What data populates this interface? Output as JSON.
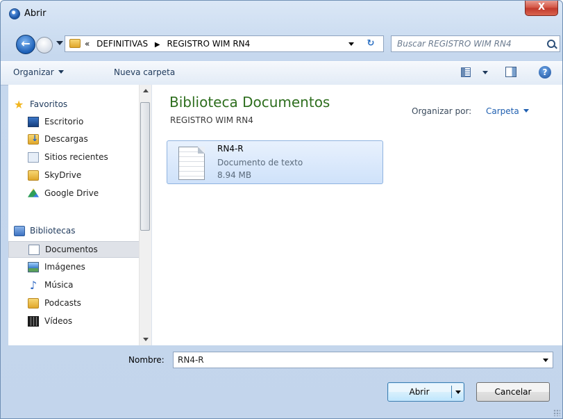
{
  "window": {
    "title": "Abrir",
    "close_label": "X"
  },
  "address": {
    "overflow": "«",
    "crumbs": [
      "DEFINITIVAS",
      "REGISTRO WIM RN4"
    ]
  },
  "search": {
    "placeholder": "Buscar REGISTRO WIM RN4"
  },
  "toolbar": {
    "organize": "Organizar",
    "new_folder": "Nueva carpeta"
  },
  "sidebar": {
    "favorites": {
      "label": "Favoritos",
      "items": [
        {
          "label": "Escritorio",
          "icon": "desktop-icon"
        },
        {
          "label": "Descargas",
          "icon": "downloads-icon"
        },
        {
          "label": "Sitios recientes",
          "icon": "recent-places-icon"
        },
        {
          "label": "SkyDrive",
          "icon": "folder-icon"
        },
        {
          "label": "Google Drive",
          "icon": "google-drive-icon"
        }
      ]
    },
    "libraries": {
      "label": "Bibliotecas",
      "items": [
        {
          "label": "Documentos",
          "icon": "document-library-icon",
          "selected": true
        },
        {
          "label": "Imágenes",
          "icon": "pictures-icon"
        },
        {
          "label": "Música",
          "icon": "music-icon"
        },
        {
          "label": "Podcasts",
          "icon": "folder-icon"
        },
        {
          "label": "Vídeos",
          "icon": "video-icon"
        }
      ]
    }
  },
  "main": {
    "library_title": "Biblioteca Documentos",
    "library_subtitle": "REGISTRO WIM RN4",
    "arrange_label": "Organizar por:",
    "arrange_value": "Carpeta",
    "files": [
      {
        "name": "RN4-R",
        "type": "Documento de texto",
        "size": "8.94 MB",
        "icon": "text-file-icon",
        "selected": true
      }
    ]
  },
  "bottom": {
    "filename_label": "Nombre:",
    "filename_value": "RN4-R",
    "open_label": "Abrir",
    "cancel_label": "Cancelar"
  },
  "colors": {
    "library_title": "#2e6e1e",
    "selection": "#cfe2fa",
    "link": "#1f5fb0"
  }
}
